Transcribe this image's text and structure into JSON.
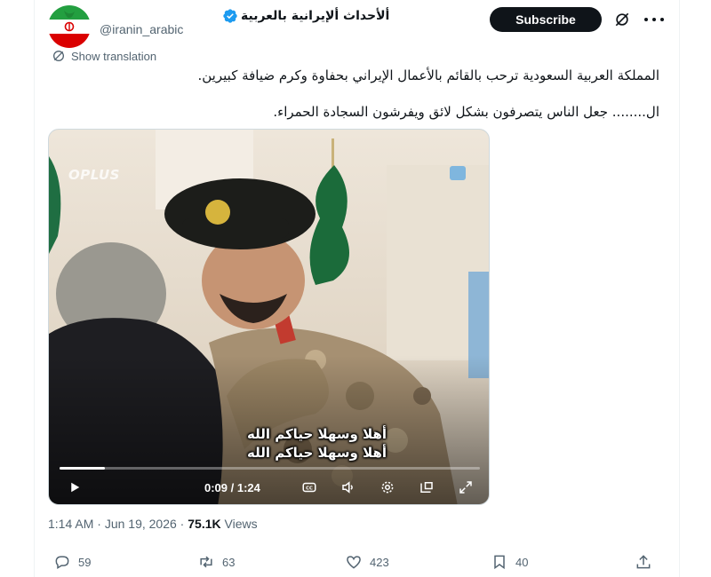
{
  "account": {
    "display_name": "ألأحداث ألإيرانية بالعربية",
    "handle": "@iranin_arabic",
    "verified": true,
    "verified_color": "#1d9bf0"
  },
  "header": {
    "subscribe_label": "Subscribe"
  },
  "translation": {
    "label": "Show translation"
  },
  "tweet": {
    "line1": "المملكة العربية السعودية ترحب بالقائم بالأعمال الإيراني بحفاوة وكرم ضيافة كبيرين.",
    "line2": "ال........ جعل الناس يتصرفون بشكل لائق ويفرشون السجادة الحمراء."
  },
  "video": {
    "watermark": "OPLUS",
    "caption_line1": "أهلا وسهلا حياكم الله",
    "caption_line2": "أهلا وسهلا حياكم الله",
    "time_display": "0:09 / 1:24",
    "progress_fraction": 0.107
  },
  "meta": {
    "time": "1:14 AM",
    "separator": " · ",
    "date": "Jun 19, 2026",
    "views_count": "75.1K",
    "views_label": " Views"
  },
  "actions": {
    "replies": "59",
    "reposts": "63",
    "likes": "423",
    "bookmarks": "40"
  },
  "icons": {
    "translation": "translate-icon",
    "grok": "grok-icon",
    "more": "more-icon",
    "play": "play-icon",
    "captions": "captions-icon",
    "volume": "volume-icon",
    "settings": "gear-icon",
    "pip": "pip-icon",
    "fullscreen": "fullscreen-icon",
    "reply": "reply-icon",
    "repost": "repost-icon",
    "like": "heart-icon",
    "bookmark": "bookmark-icon",
    "share": "share-icon"
  },
  "colors": {
    "text_primary": "#0f1419",
    "text_secondary": "#536471",
    "subscribe_bg": "#0f1419",
    "flag_green": "#239f40",
    "flag_red": "#da0000"
  }
}
